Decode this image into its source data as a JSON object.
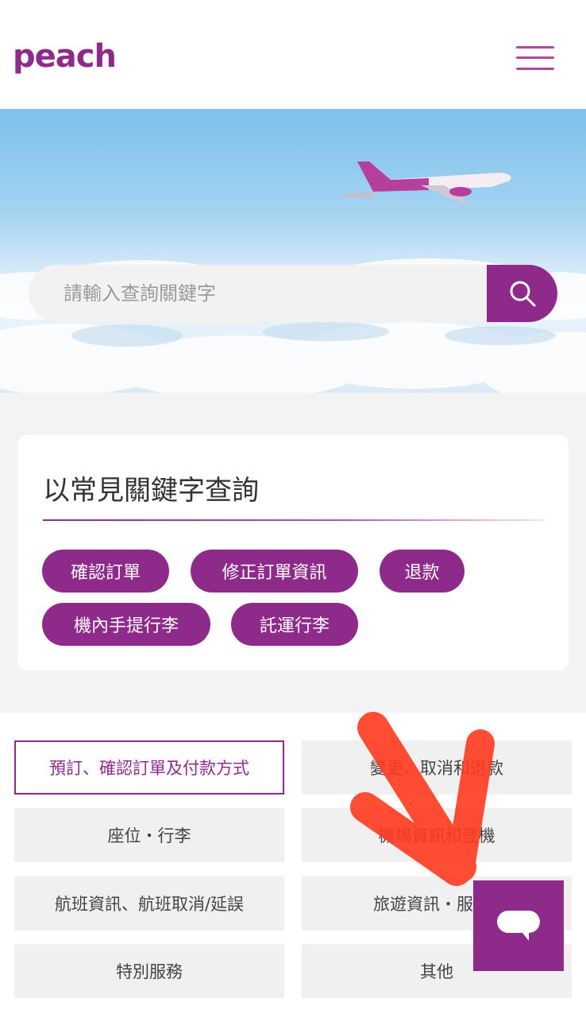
{
  "header": {
    "logo_text": "peach"
  },
  "search": {
    "placeholder": "請輸入查詢關鍵字"
  },
  "keywords": {
    "title": "以常見關鍵字查詢",
    "tags": [
      "確認訂單",
      "修正訂單資訊",
      "退款",
      "機內手提行李",
      "託運行李"
    ]
  },
  "categories": [
    "預訂、確認訂單及付款方式",
    "變更、取消和退款",
    "座位・行李",
    "機場資訊和登機",
    "航班資訊、航班取消/延誤",
    "旅遊資訊・服",
    "特別服務",
    "其他"
  ],
  "colors": {
    "brand": "#8e2b8a",
    "annotation": "#ff3b1f"
  },
  "icons": {
    "menu": "hamburger-menu-icon",
    "search": "search-icon",
    "chat": "chat-bubble-icon"
  }
}
